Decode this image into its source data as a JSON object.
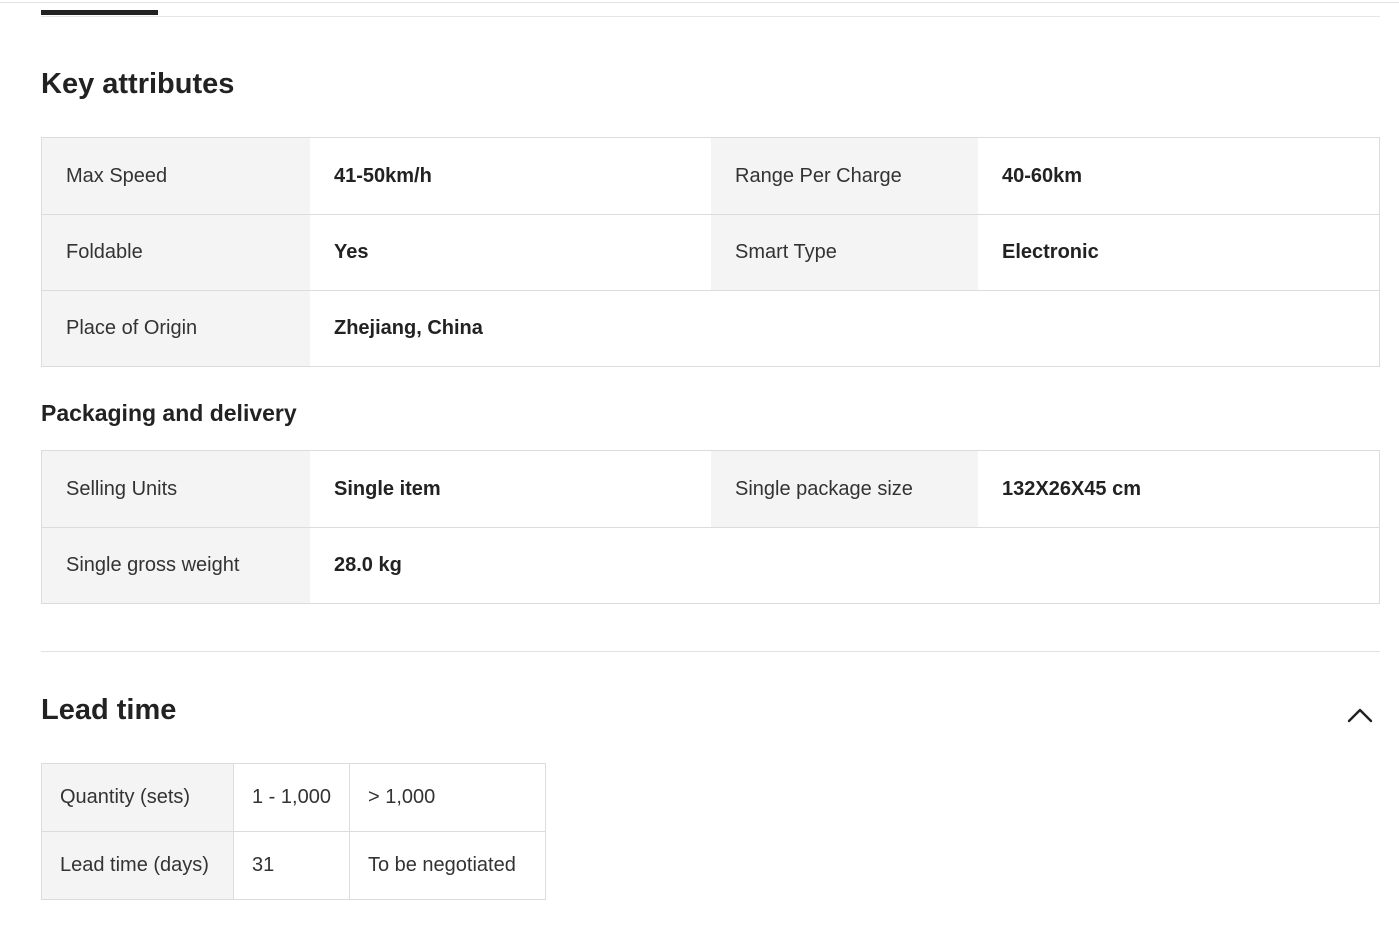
{
  "sections": {
    "key_attributes": "Key attributes",
    "packaging": "Packaging and delivery",
    "lead_time": "Lead time"
  },
  "key_attributes": [
    {
      "label": "Max Speed",
      "value": "41-50km/h",
      "label2": "Range Per Charge",
      "value2": "40-60km"
    },
    {
      "label": "Foldable",
      "value": "Yes",
      "label2": "Smart Type",
      "value2": "Electronic"
    },
    {
      "label": "Place of Origin",
      "value": "Zhejiang, China"
    }
  ],
  "packaging": [
    {
      "label": "Selling Units",
      "value": "Single item",
      "label2": "Single package size",
      "value2": "132X26X45 cm"
    },
    {
      "label": "Single gross weight",
      "value": "28.0 kg"
    }
  ],
  "lead_time_table": {
    "header_quantity": "Quantity (sets)",
    "header_days": "Lead time (days)",
    "ranges": [
      "1 - 1,000",
      "> 1,000"
    ],
    "days": [
      "31",
      "To be negotiated"
    ]
  },
  "icons": {
    "collapse": "chevron-up-icon"
  }
}
